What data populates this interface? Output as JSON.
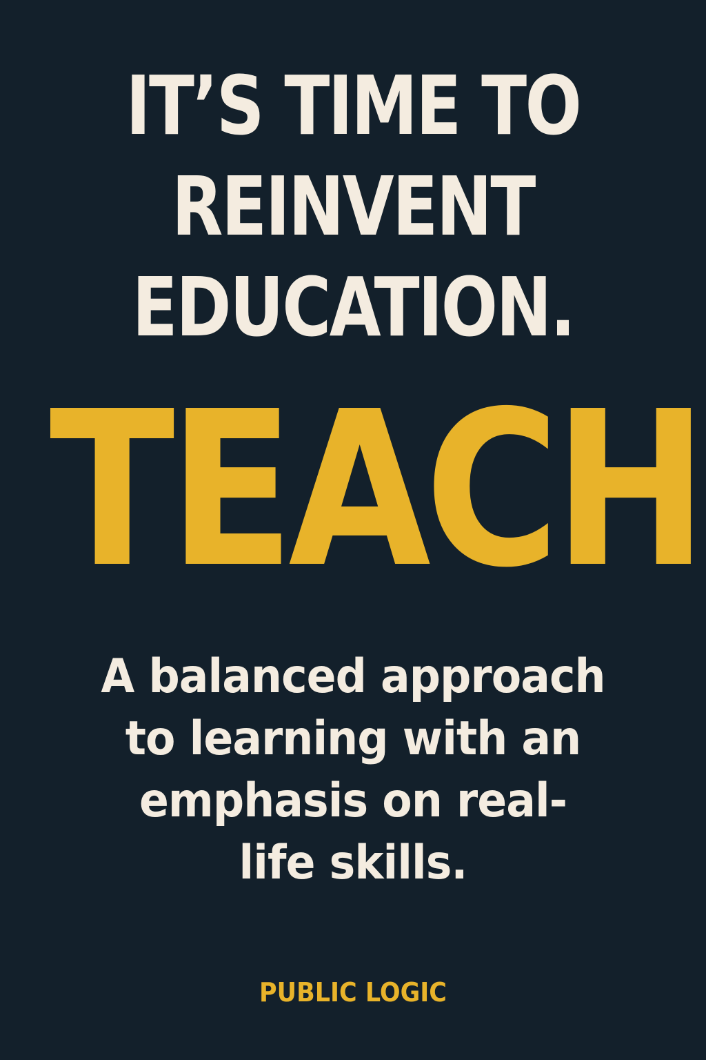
{
  "colors": {
    "background": "#13202b",
    "cream_text": "#f4ece0",
    "accent_gold": "#e8b32a"
  },
  "headline": {
    "lines": [
      "IT’S TIME TO",
      "REINVENT",
      "EDUCATION."
    ]
  },
  "hero_word": "TEACH",
  "subhead": {
    "lines": [
      "A balanced approach",
      "to learning with an",
      "emphasis on real-",
      "life skills."
    ]
  },
  "brand": "PUBLIC LOGIC"
}
